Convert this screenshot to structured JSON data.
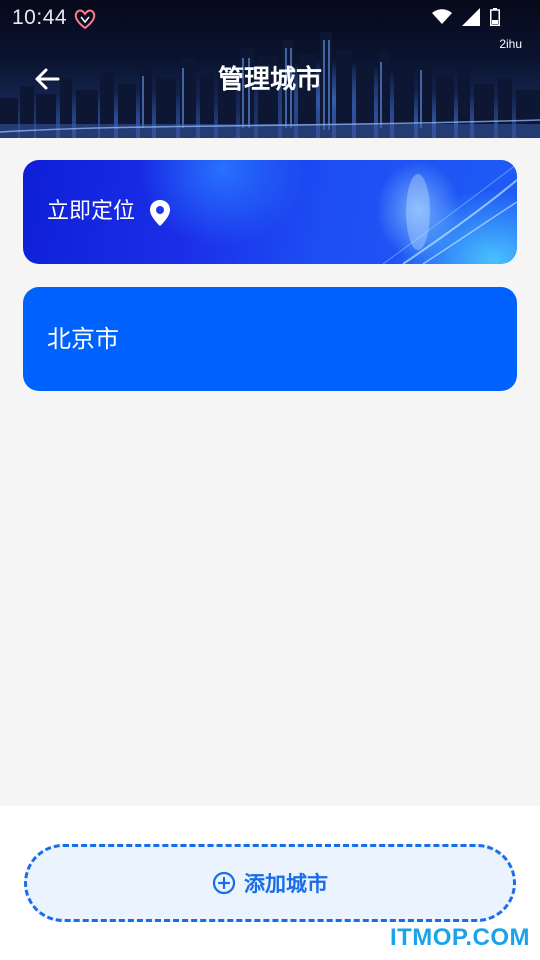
{
  "status_bar": {
    "time": "10:44",
    "logo_icon": "app-heart-logo-icon",
    "icons": [
      "wifi-icon",
      "signal-icon",
      "battery-icon"
    ],
    "label": "2ihu"
  },
  "header": {
    "title": "管理城市",
    "back_icon": "arrow-left-icon"
  },
  "locate_card": {
    "label": "立即定位",
    "icon": "location-pin-icon"
  },
  "cities": [
    {
      "name": "北京市"
    }
  ],
  "add_city": {
    "label": "添加城市",
    "icon": "plus-circle-icon"
  },
  "watermark": "ITMOP.COM",
  "colors": {
    "primary": "#0062fe",
    "accent": "#1a6de8",
    "add_button_bg": "#ebf3fe",
    "page_bg": "#f5f5f5",
    "watermark": "#1aa3e8"
  }
}
